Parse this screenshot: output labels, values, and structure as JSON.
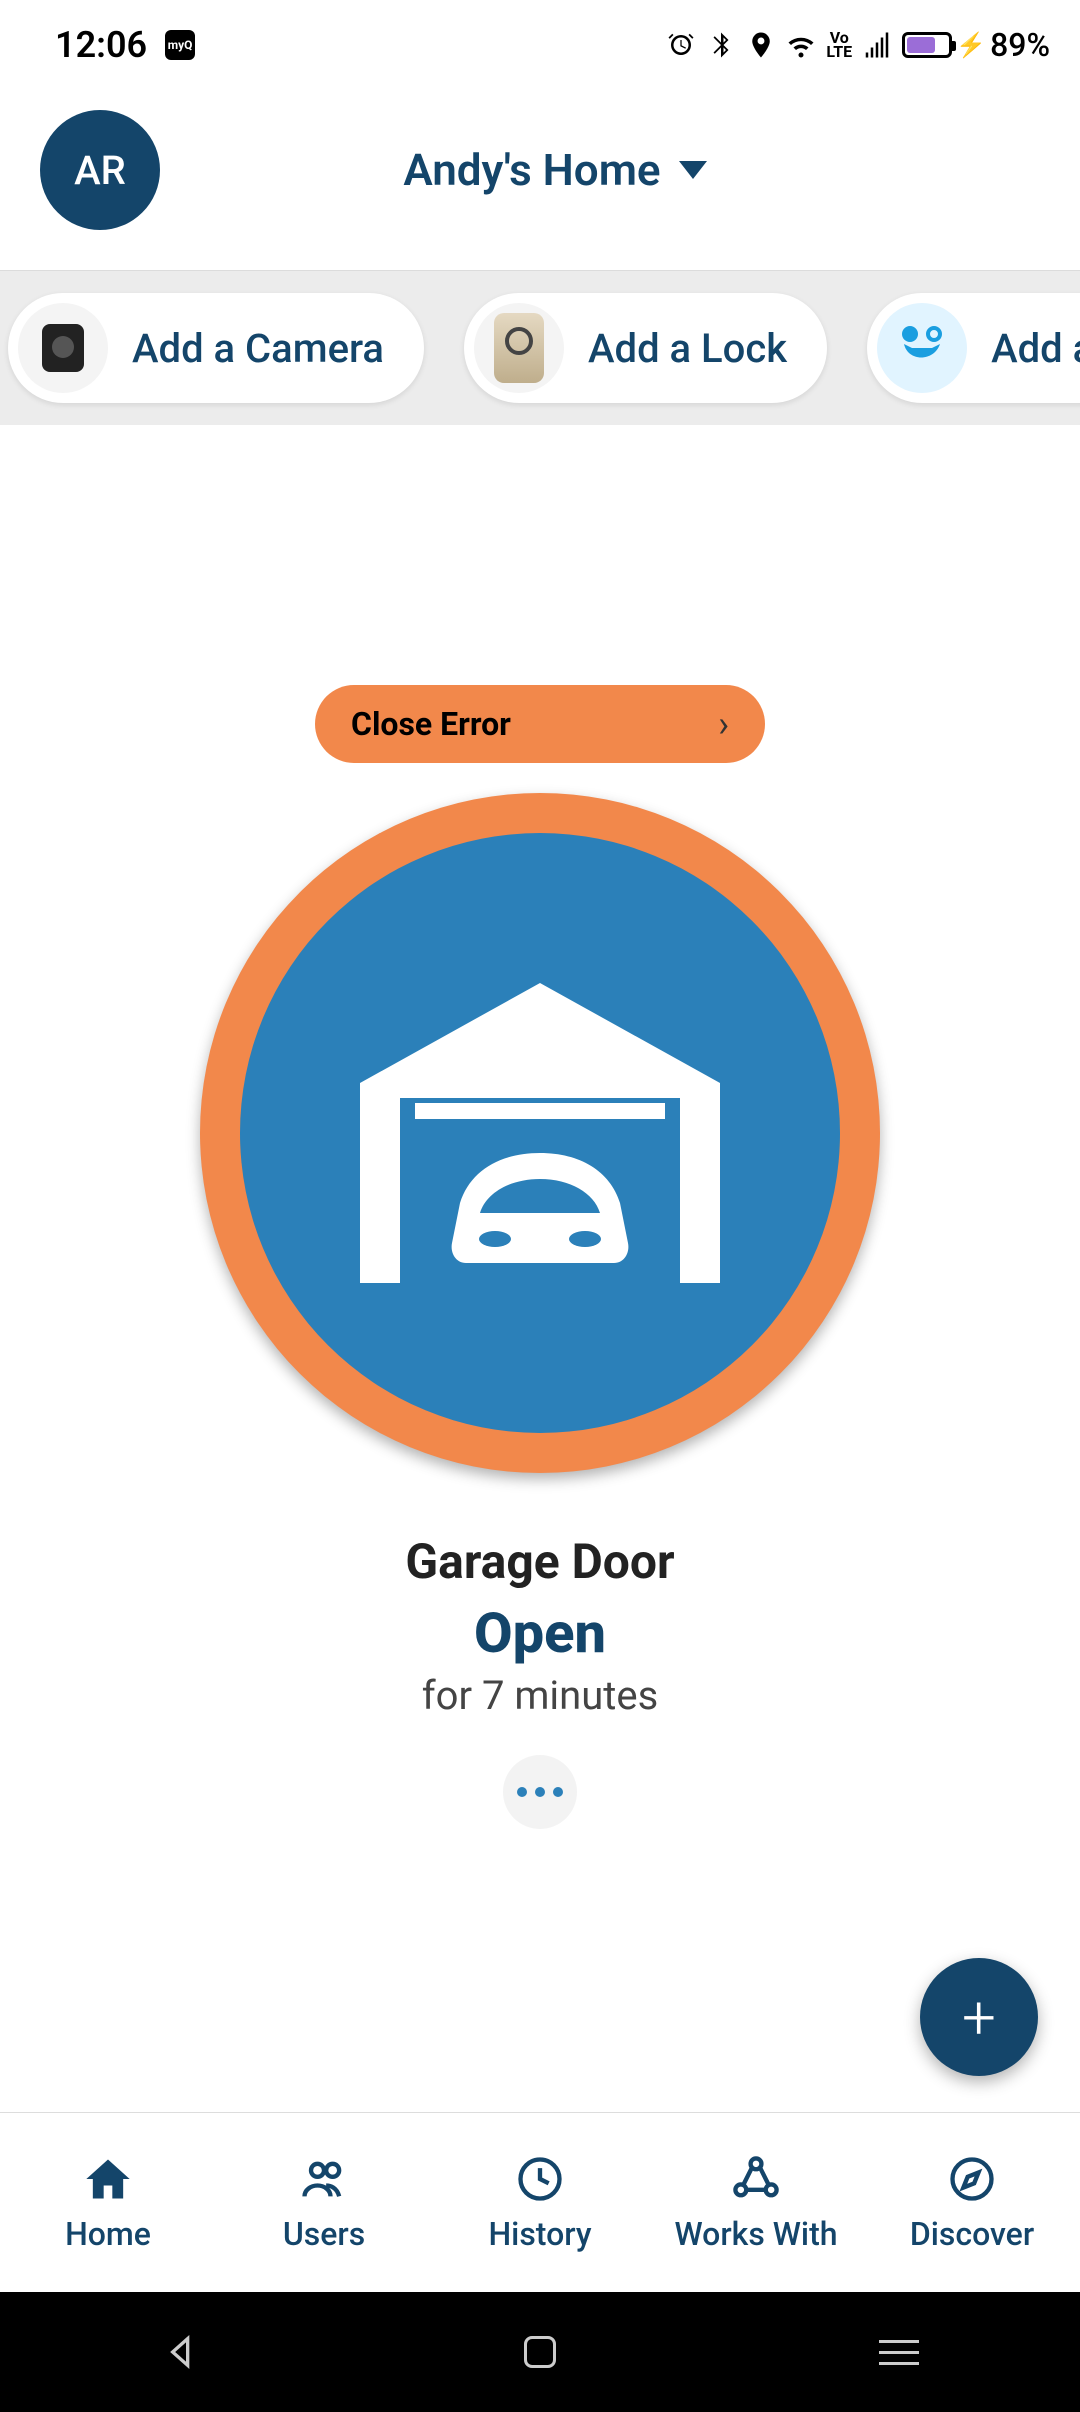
{
  "status": {
    "time": "12:06",
    "app_badge": "myQ",
    "battery_pct": "89%"
  },
  "header": {
    "avatar_initials": "AR",
    "home_name": "Andy's Home"
  },
  "chips": [
    {
      "label": "Add a Camera",
      "icon": "camera"
    },
    {
      "label": "Add a Lock",
      "icon": "lock"
    },
    {
      "label": "Add a Co",
      "icon": "controller"
    }
  ],
  "error": {
    "label": "Close Error"
  },
  "device": {
    "name": "Garage Door",
    "state": "Open",
    "duration": "for 7 minutes"
  },
  "nav": {
    "home": "Home",
    "users": "Users",
    "history": "History",
    "works_with": "Works With",
    "discover": "Discover"
  },
  "colors": {
    "brand_dark": "#14456a",
    "accent_orange": "#f2884b",
    "device_blue": "#2b80b9"
  }
}
